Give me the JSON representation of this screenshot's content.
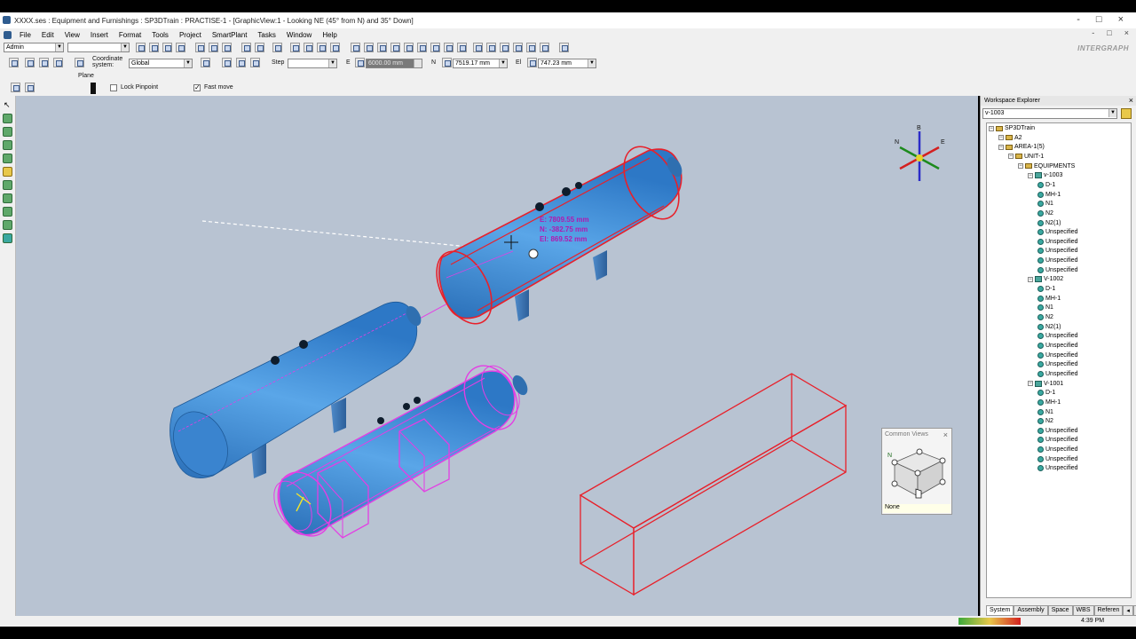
{
  "window": {
    "title": "XXXX.ses : Equipment and Furnishings : SP3DTrain : PRACTISE-1 - [GraphicView:1 - Looking NE (45° from N) and 35° Down]",
    "controls": [
      "-",
      "□",
      "×"
    ]
  },
  "menu": [
    "File",
    "Edit",
    "View",
    "Insert",
    "Format",
    "Tools",
    "Project",
    "SmartPlant",
    "Tasks",
    "Window",
    "Help"
  ],
  "toolbar": {
    "role_combo": "Admin",
    "filter_combo": "",
    "brand": "INTERGRAPH",
    "coordinate_system_label": "Coordinate system:",
    "coordinate_system_value": "Global",
    "step_label": "Step",
    "step_value": "",
    "e_label": "E",
    "e_value": "6000.00 mm",
    "n_label": "N",
    "n_value": "7519.17 mm",
    "el_label": "El",
    "el_value": "747.23 mm",
    "plane_label": "Plane",
    "lock_pinpoint_label": "Lock Pinpoint",
    "fast_move_label": "Fast move",
    "fast_move_checked": true
  },
  "viewport": {
    "measure_lines": [
      "E:  7809.55 mm",
      "N:  -382.75 mm",
      "El:  869.52 mm"
    ],
    "compass": {
      "b": "B",
      "n": "N",
      "e": "E"
    },
    "colors": {
      "background": "#b8c3d2",
      "vessel": "#3f8fd8",
      "select": "#e8202a",
      "highlight": "#e43ee4"
    }
  },
  "common_views": {
    "title": "Common Views",
    "compass_n": "N",
    "current": "None"
  },
  "explorer": {
    "title": "Workspace Explorer",
    "filter": "v-1003",
    "tree": [
      {
        "label": "SP3DTrain",
        "level": 0,
        "icon": "folder"
      },
      {
        "label": "A2",
        "level": 1,
        "icon": "folder"
      },
      {
        "label": "AREA-1(5)",
        "level": 1,
        "icon": "folder"
      },
      {
        "label": "UNIT-1",
        "level": 2,
        "icon": "folder"
      },
      {
        "label": "EQUIPMENTS",
        "level": 3,
        "icon": "folder"
      },
      {
        "label": "v-1003",
        "level": 4,
        "icon": "equipment"
      },
      {
        "label": "D-1",
        "level": 5,
        "icon": "nozzle"
      },
      {
        "label": "MH-1",
        "level": 5,
        "icon": "nozzle"
      },
      {
        "label": "N1",
        "level": 5,
        "icon": "nozzle"
      },
      {
        "label": "N2",
        "level": 5,
        "icon": "nozzle"
      },
      {
        "label": "N2(1)",
        "level": 5,
        "icon": "nozzle"
      },
      {
        "label": "Unspecified",
        "level": 5,
        "icon": "shape"
      },
      {
        "label": "Unspecified",
        "level": 5,
        "icon": "shape"
      },
      {
        "label": "Unspecified",
        "level": 5,
        "icon": "shape"
      },
      {
        "label": "Unspecified",
        "level": 5,
        "icon": "shape"
      },
      {
        "label": "Unspecified",
        "level": 5,
        "icon": "shape"
      },
      {
        "label": "V-1002",
        "level": 4,
        "icon": "equipment"
      },
      {
        "label": "D-1",
        "level": 5,
        "icon": "nozzle"
      },
      {
        "label": "MH-1",
        "level": 5,
        "icon": "nozzle"
      },
      {
        "label": "N1",
        "level": 5,
        "icon": "nozzle"
      },
      {
        "label": "N2",
        "level": 5,
        "icon": "nozzle"
      },
      {
        "label": "N2(1)",
        "level": 5,
        "icon": "nozzle"
      },
      {
        "label": "Unspecified",
        "level": 5,
        "icon": "shape"
      },
      {
        "label": "Unspecified",
        "level": 5,
        "icon": "shape"
      },
      {
        "label": "Unspecified",
        "level": 5,
        "icon": "shape"
      },
      {
        "label": "Unspecified",
        "level": 5,
        "icon": "shape"
      },
      {
        "label": "Unspecified",
        "level": 5,
        "icon": "shape"
      },
      {
        "label": "V-1001",
        "level": 4,
        "icon": "equipment"
      },
      {
        "label": "D-1",
        "level": 5,
        "icon": "nozzle"
      },
      {
        "label": "MH-1",
        "level": 5,
        "icon": "nozzle"
      },
      {
        "label": "N1",
        "level": 5,
        "icon": "nozzle"
      },
      {
        "label": "N2",
        "level": 5,
        "icon": "nozzle"
      },
      {
        "label": "Unspecified",
        "level": 5,
        "icon": "shape"
      },
      {
        "label": "Unspecified",
        "level": 5,
        "icon": "shape"
      },
      {
        "label": "Unspecified",
        "level": 5,
        "icon": "shape"
      },
      {
        "label": "Unspecified",
        "level": 5,
        "icon": "shape"
      },
      {
        "label": "Unspecified",
        "level": 5,
        "icon": "shape"
      }
    ],
    "tabs": [
      "System",
      "Assembly",
      "Space",
      "WBS",
      "Referen"
    ]
  },
  "status": {
    "clock": "4:39 PM"
  }
}
